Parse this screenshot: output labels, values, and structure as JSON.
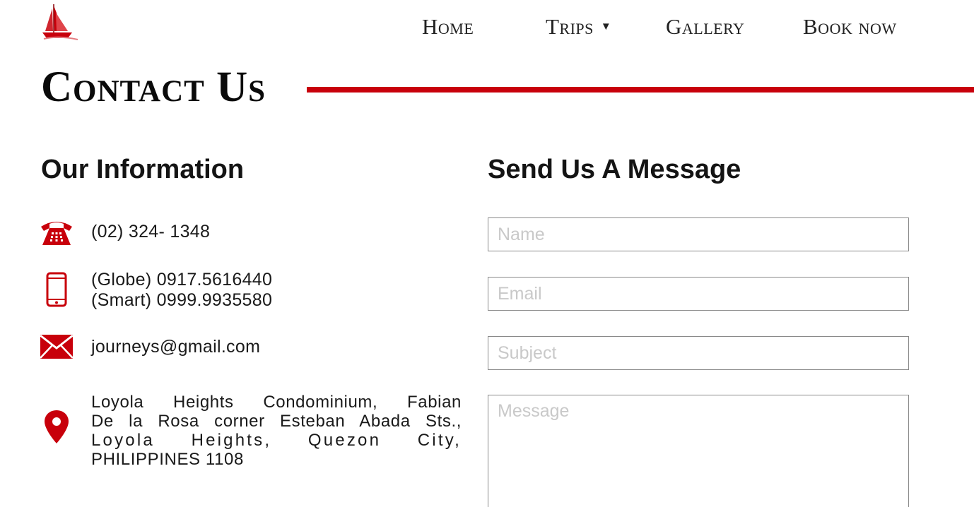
{
  "brand": {
    "accent_color": "#c8000b",
    "logo_icon": "sailing-ship-icon"
  },
  "nav": {
    "home": "Home",
    "trips": "Trips",
    "trips_caret": "▼",
    "gallery": "Gallery",
    "book_now": "Book now"
  },
  "page": {
    "title": "Contact Us"
  },
  "info": {
    "heading": "Our Information",
    "phone_icon": "telephone-icon",
    "phone": "(02) 324- 1348",
    "mobile_icon": "mobile-phone-icon",
    "mobile_globe": "(Globe) 0917.5616440",
    "mobile_smart": "(Smart) 0999.9935580",
    "email_icon": "envelope-icon",
    "email": "journeys@gmail.com",
    "address_icon": "map-pin-icon",
    "address_line1": "Loyola Heights Condominium, Fabian",
    "address_line2": "De la Rosa corner Esteban Abada Sts.,",
    "address_line3": "Loyola Heights, Quezon City,",
    "address_line4": "PHILIPPINES 1108"
  },
  "form": {
    "heading": "Send Us A Message",
    "name_placeholder": "Name",
    "email_placeholder": "Email",
    "subject_placeholder": "Subject",
    "message_placeholder": "Message"
  }
}
